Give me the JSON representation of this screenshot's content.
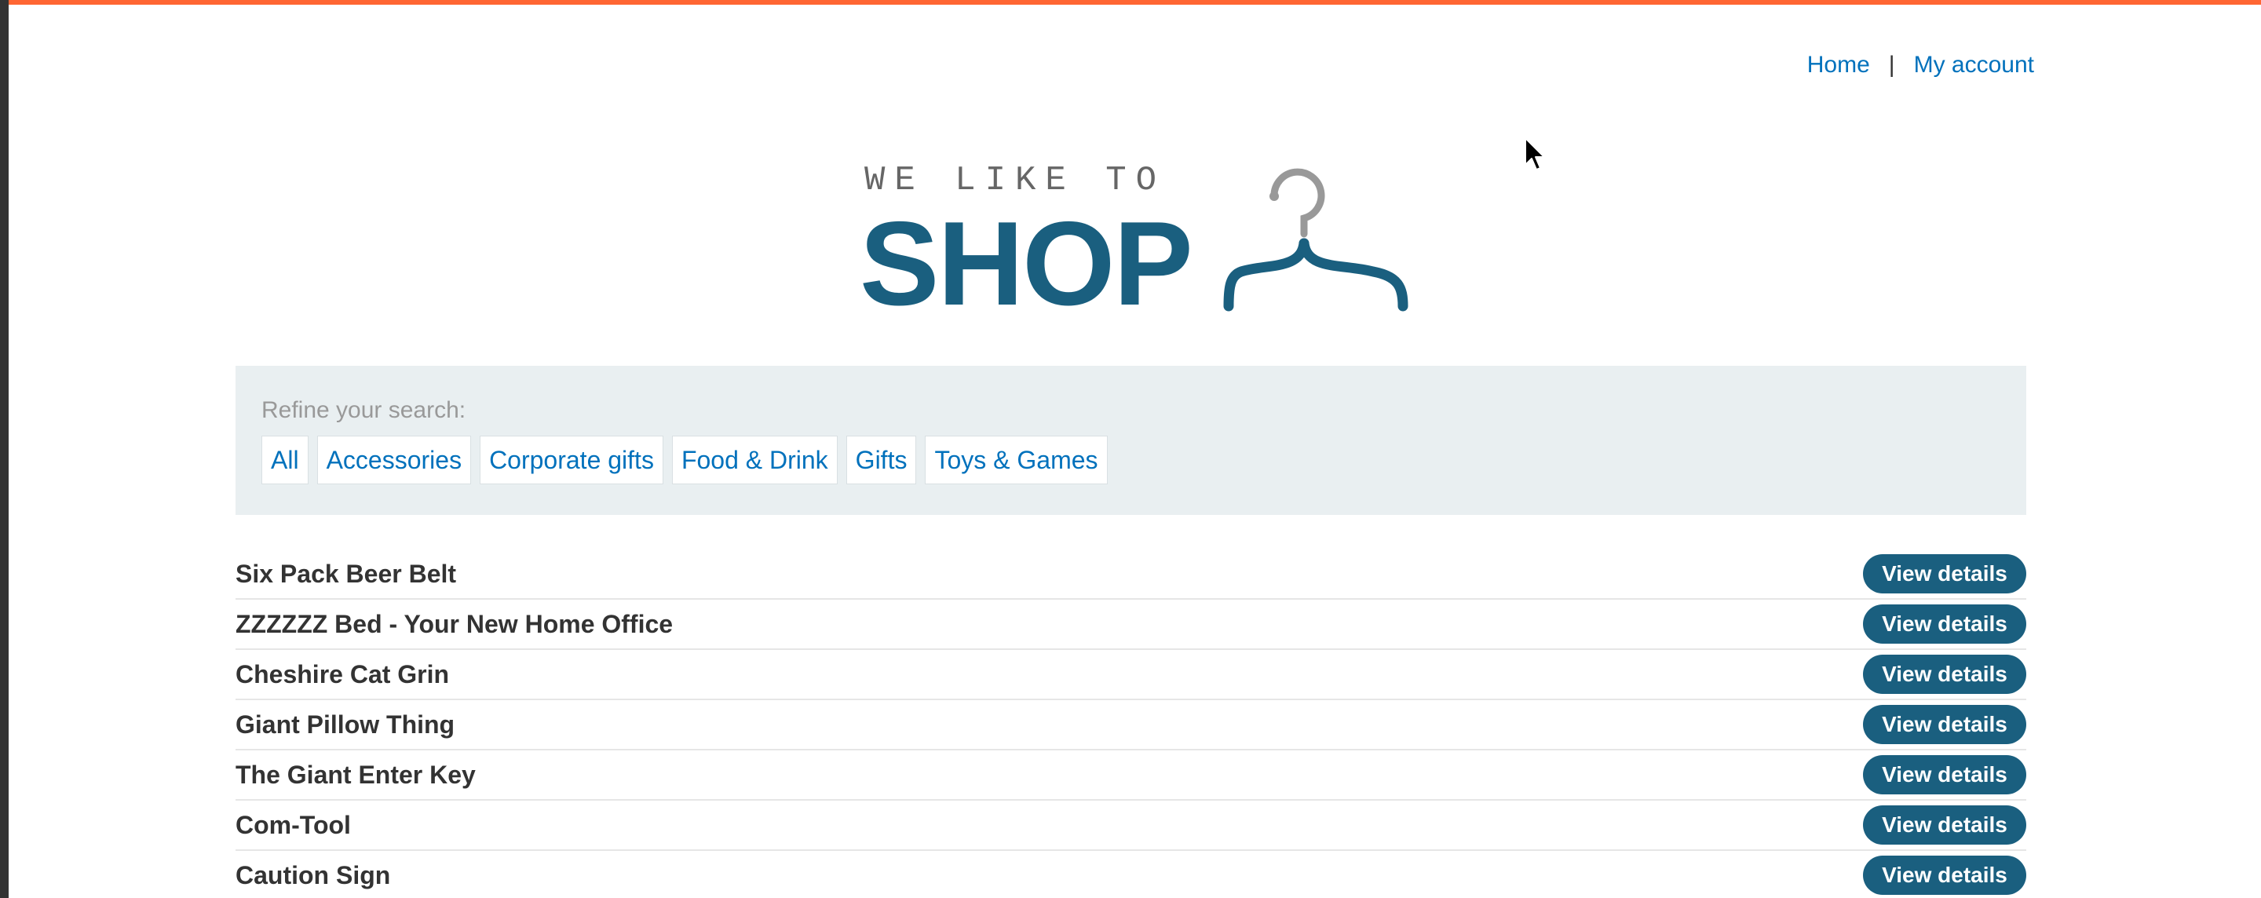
{
  "nav": {
    "home": "Home",
    "separator": "|",
    "my_account": "My account"
  },
  "logo": {
    "tagline": "WE LIKE TO",
    "word": "SHOP",
    "icon": "clothes-hanger-icon"
  },
  "filter": {
    "label": "Refine your search:",
    "categories": [
      "All",
      "Accessories",
      "Corporate gifts",
      "Food & Drink",
      "Gifts",
      "Toys & Games"
    ]
  },
  "products": [
    {
      "name": "Six Pack Beer Belt",
      "button": "View details"
    },
    {
      "name": "ZZZZZZ Bed - Your New Home Office",
      "button": "View details"
    },
    {
      "name": "Cheshire Cat Grin",
      "button": "View details"
    },
    {
      "name": "Giant Pillow Thing",
      "button": "View details"
    },
    {
      "name": "The Giant Enter Key",
      "button": "View details"
    },
    {
      "name": "Com-Tool",
      "button": "View details"
    },
    {
      "name": "Caution Sign",
      "button": "View details"
    }
  ],
  "colors": {
    "accent_bar": "#ff6633",
    "brand": "#1a5f7f",
    "link": "#0071bc",
    "panel": "#e9eff1"
  }
}
